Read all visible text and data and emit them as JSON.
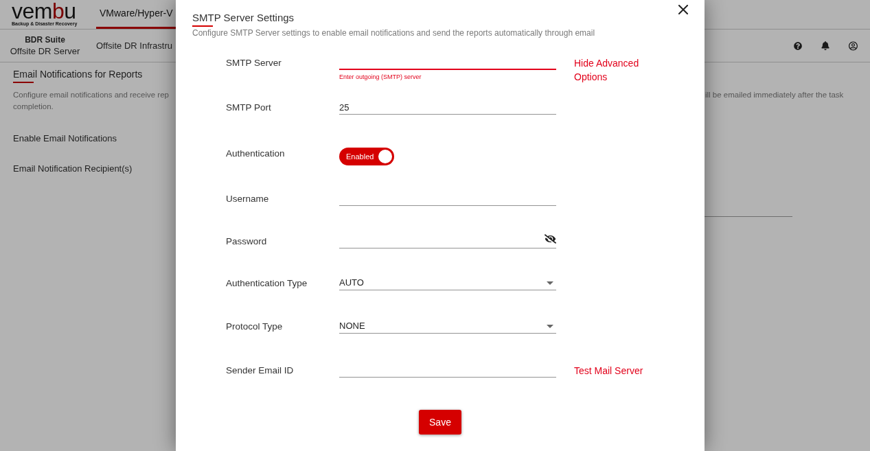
{
  "header": {
    "logo": {
      "wordmark": "vembu",
      "tagline": "Backup & Disaster Recovery"
    },
    "tabs": [
      {
        "label": "VMware/Hyper-V",
        "selected": true
      }
    ]
  },
  "subheader": {
    "product": {
      "suite": "BDR Suite",
      "name": "Offsite DR Server"
    },
    "nav_items": [
      {
        "label": "Offsite DR Infrastru"
      }
    ]
  },
  "page": {
    "title": "Email Notifications for Reports",
    "description_fragments": [
      "Configure email notifications and receive rep",
      "ill be emailed immediately after the task",
      "completion."
    ],
    "settings": [
      {
        "label": "Enable Email Notifications"
      },
      {
        "label": "Email Notification Recipient(s)"
      }
    ]
  },
  "dialog": {
    "title": "SMTP Server Settings",
    "description": "Configure SMTP Server settings to enable email notifications and send the reports automatically through email",
    "fields": [
      {
        "kind": "text",
        "label": "SMTP Server",
        "error": "Enter outgoing (SMTP) server",
        "link": "Hide Advanced Options"
      },
      {
        "kind": "text",
        "label": "SMTP Port",
        "value": "25"
      },
      {
        "kind": "toggle",
        "label": "Authentication",
        "on": true,
        "state_label": "Enabled"
      },
      {
        "kind": "text",
        "label": "Username"
      },
      {
        "kind": "password",
        "label": "Password"
      },
      {
        "kind": "select",
        "label": "Authentication Type",
        "value": "AUTO"
      },
      {
        "kind": "select",
        "label": "Protocol Type",
        "value": "NONE"
      },
      {
        "kind": "text",
        "label": "Sender Email ID",
        "link": "Test Mail Server"
      }
    ],
    "save_button": "Save"
  }
}
